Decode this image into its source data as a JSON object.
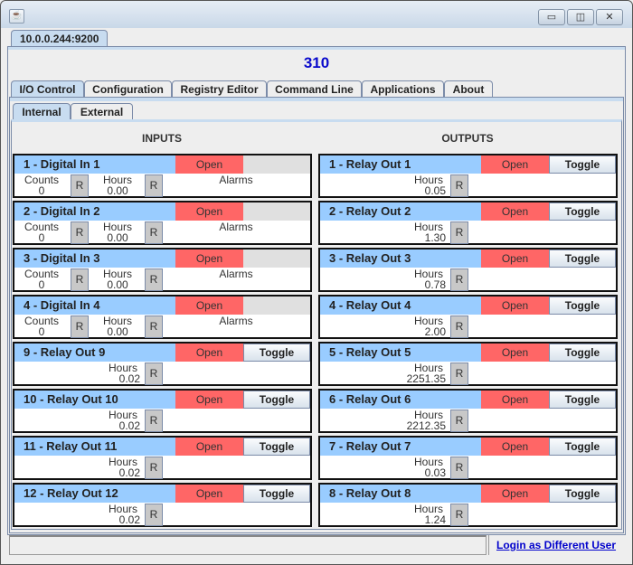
{
  "window": {
    "title": "",
    "controls": {
      "minimize": "▭",
      "maximize": "◫",
      "close": "✕"
    }
  },
  "connection_tab": "10.0.0.244:9200",
  "device_id": "310",
  "tabs": [
    {
      "label": "I/O Control",
      "active": true
    },
    {
      "label": "Configuration",
      "active": false
    },
    {
      "label": "Registry Editor",
      "active": false
    },
    {
      "label": "Command Line",
      "active": false
    },
    {
      "label": "Applications",
      "active": false
    },
    {
      "label": "About",
      "active": false
    }
  ],
  "subtabs": [
    {
      "label": "Internal",
      "active": true
    },
    {
      "label": "External",
      "active": false
    }
  ],
  "inputs_header": "INPUTS",
  "outputs_header": "OUTPUTS",
  "labels": {
    "counts": "Counts",
    "hours": "Hours",
    "alarms": "Alarms",
    "reset": "R",
    "toggle": "Toggle"
  },
  "colors": {
    "name_bg": "#99ccff",
    "state_open": "#ff6666",
    "link": "#0000cc",
    "device_id": "#0a0acc"
  },
  "inputs": [
    {
      "name": "1 - Digital In 1",
      "state": "Open",
      "counts": "0",
      "hours": "0.00"
    },
    {
      "name": "2 - Digital In 2",
      "state": "Open",
      "counts": "0",
      "hours": "0.00"
    },
    {
      "name": "3 - Digital In 3",
      "state": "Open",
      "counts": "0",
      "hours": "0.00"
    },
    {
      "name": "4 - Digital In 4",
      "state": "Open",
      "counts": "0",
      "hours": "0.00"
    }
  ],
  "left_relays": [
    {
      "name": "9 - Relay Out 9",
      "state": "Open",
      "hours": "0.02"
    },
    {
      "name": "10 - Relay Out 10",
      "state": "Open",
      "hours": "0.02"
    },
    {
      "name": "11 - Relay Out 11",
      "state": "Open",
      "hours": "0.02"
    },
    {
      "name": "12 - Relay Out 12",
      "state": "Open",
      "hours": "0.02"
    }
  ],
  "outputs": [
    {
      "name": "1 - Relay Out 1",
      "state": "Open",
      "hours": "0.05"
    },
    {
      "name": "2 - Relay Out 2",
      "state": "Open",
      "hours": "1.30"
    },
    {
      "name": "3 - Relay Out 3",
      "state": "Open",
      "hours": "0.78"
    },
    {
      "name": "4 - Relay Out 4",
      "state": "Open",
      "hours": "2.00"
    },
    {
      "name": "5 - Relay Out 5",
      "state": "Open",
      "hours": "2251.35"
    },
    {
      "name": "6 - Relay Out 6",
      "state": "Open",
      "hours": "2212.35"
    },
    {
      "name": "7 - Relay Out 7",
      "state": "Open",
      "hours": "0.03"
    },
    {
      "name": "8 - Relay Out 8",
      "state": "Open",
      "hours": "1.24"
    }
  ],
  "status_bar": {
    "left_text": "",
    "login_link": "Login as Different User"
  }
}
